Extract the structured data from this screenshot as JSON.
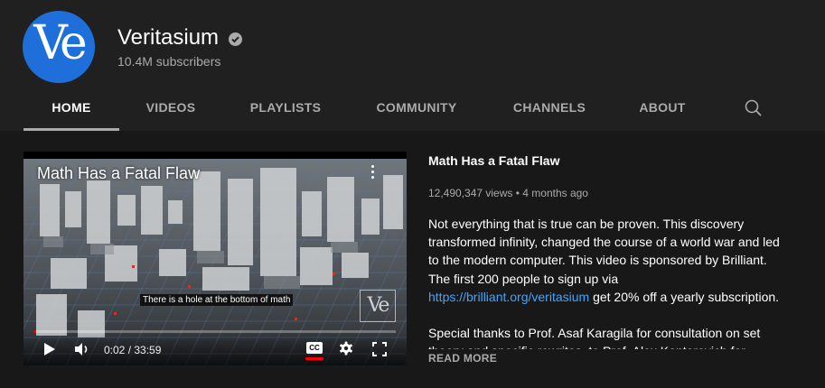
{
  "channel": {
    "name": "Veritasium",
    "subscribers": "10.4M subscribers",
    "avatar_text": "Ve",
    "verified": true,
    "avatar_color": "#1e6fd9"
  },
  "tabs": [
    {
      "label": "HOME",
      "active": true
    },
    {
      "label": "VIDEOS",
      "active": false
    },
    {
      "label": "PLAYLISTS",
      "active": false
    },
    {
      "label": "COMMUNITY",
      "active": false
    },
    {
      "label": "CHANNELS",
      "active": false
    },
    {
      "label": "ABOUT",
      "active": false
    }
  ],
  "search_icon": "search-icon",
  "player": {
    "title": "Math Has a Fatal Flaw",
    "caption": "There is a hole at the bottom of math",
    "watermark": "Ve",
    "time": "0:02 / 33:59",
    "progress_fraction": 0.001,
    "cc_label": "CC",
    "progress_color": "#ff0000"
  },
  "video": {
    "title": "Math Has a Fatal Flaw",
    "meta": "12,490,347 views • 4 months ago",
    "description_1a": "Not everything that is true can be proven. This discovery transformed infinity, changed the course of a world war and led to the modern computer. This video is sponsored by Brilliant. The first 200 people to sign up via ",
    "description_link": "https://brilliant.org/veritasium",
    "description_1b": " get 20% off a yearly subscription.",
    "description_2": "Special thanks to Prof. Asaf Karagila for consultation on set theory and specific rewrites, to Prof. Alex Kontorovich for reviews of earlier drafts.",
    "read_more": "READ MORE",
    "link_color": "#3ea6ff"
  }
}
